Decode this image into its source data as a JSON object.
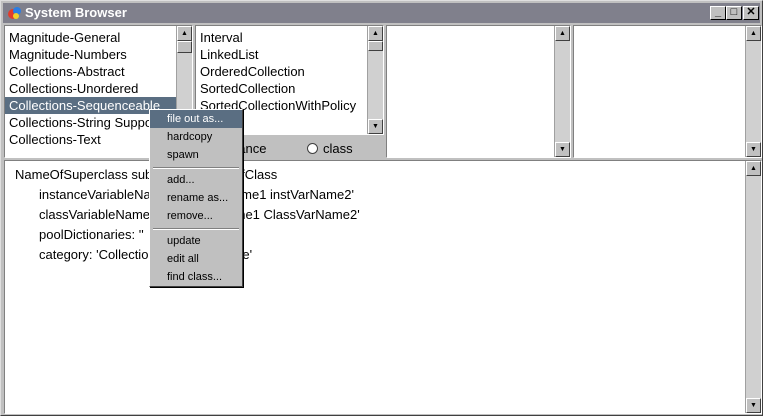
{
  "window": {
    "title": "System Browser",
    "minimize": "_",
    "maximize": "□",
    "close": "✕"
  },
  "categories": {
    "items": [
      "Magnitude-General",
      "Magnitude-Numbers",
      "Collections-Abstract",
      "Collections-Unordered",
      "Collections-Sequenceable",
      "Collections-String Support",
      "Collections-Text"
    ],
    "selected_index": 4
  },
  "classes": {
    "items": [
      "Interval",
      "LinkedList",
      "OrderedCollection",
      "SortedCollection",
      "SortedCollectionWithPolicy"
    ]
  },
  "mode": {
    "instance_label": "instance",
    "class_label": "class"
  },
  "code": {
    "lines": [
      "NameOfSuperclass subclass: #NameOfClass",
      "instanceVariableNames: 'instVarName1 instVarName2'",
      "classVariableNames: 'ClassVarName1 ClassVarName2'",
      "poolDictionaries: ''",
      "category: 'Collections-Sequenceable'"
    ]
  },
  "context_menu": {
    "items": [
      "file out as...",
      "hardcopy",
      "spawn",
      "add...",
      "rename as...",
      "remove...",
      "update",
      "edit all",
      "find class..."
    ],
    "active_index": 0
  },
  "icons": {
    "app": "squeak-logo-icon",
    "scroll_up": "arrow-up-icon",
    "scroll_down": "arrow-down-icon"
  },
  "colors": {
    "titlebar": "#80808c",
    "selection": "#5a6e82",
    "chrome": "#c0c0c0"
  }
}
